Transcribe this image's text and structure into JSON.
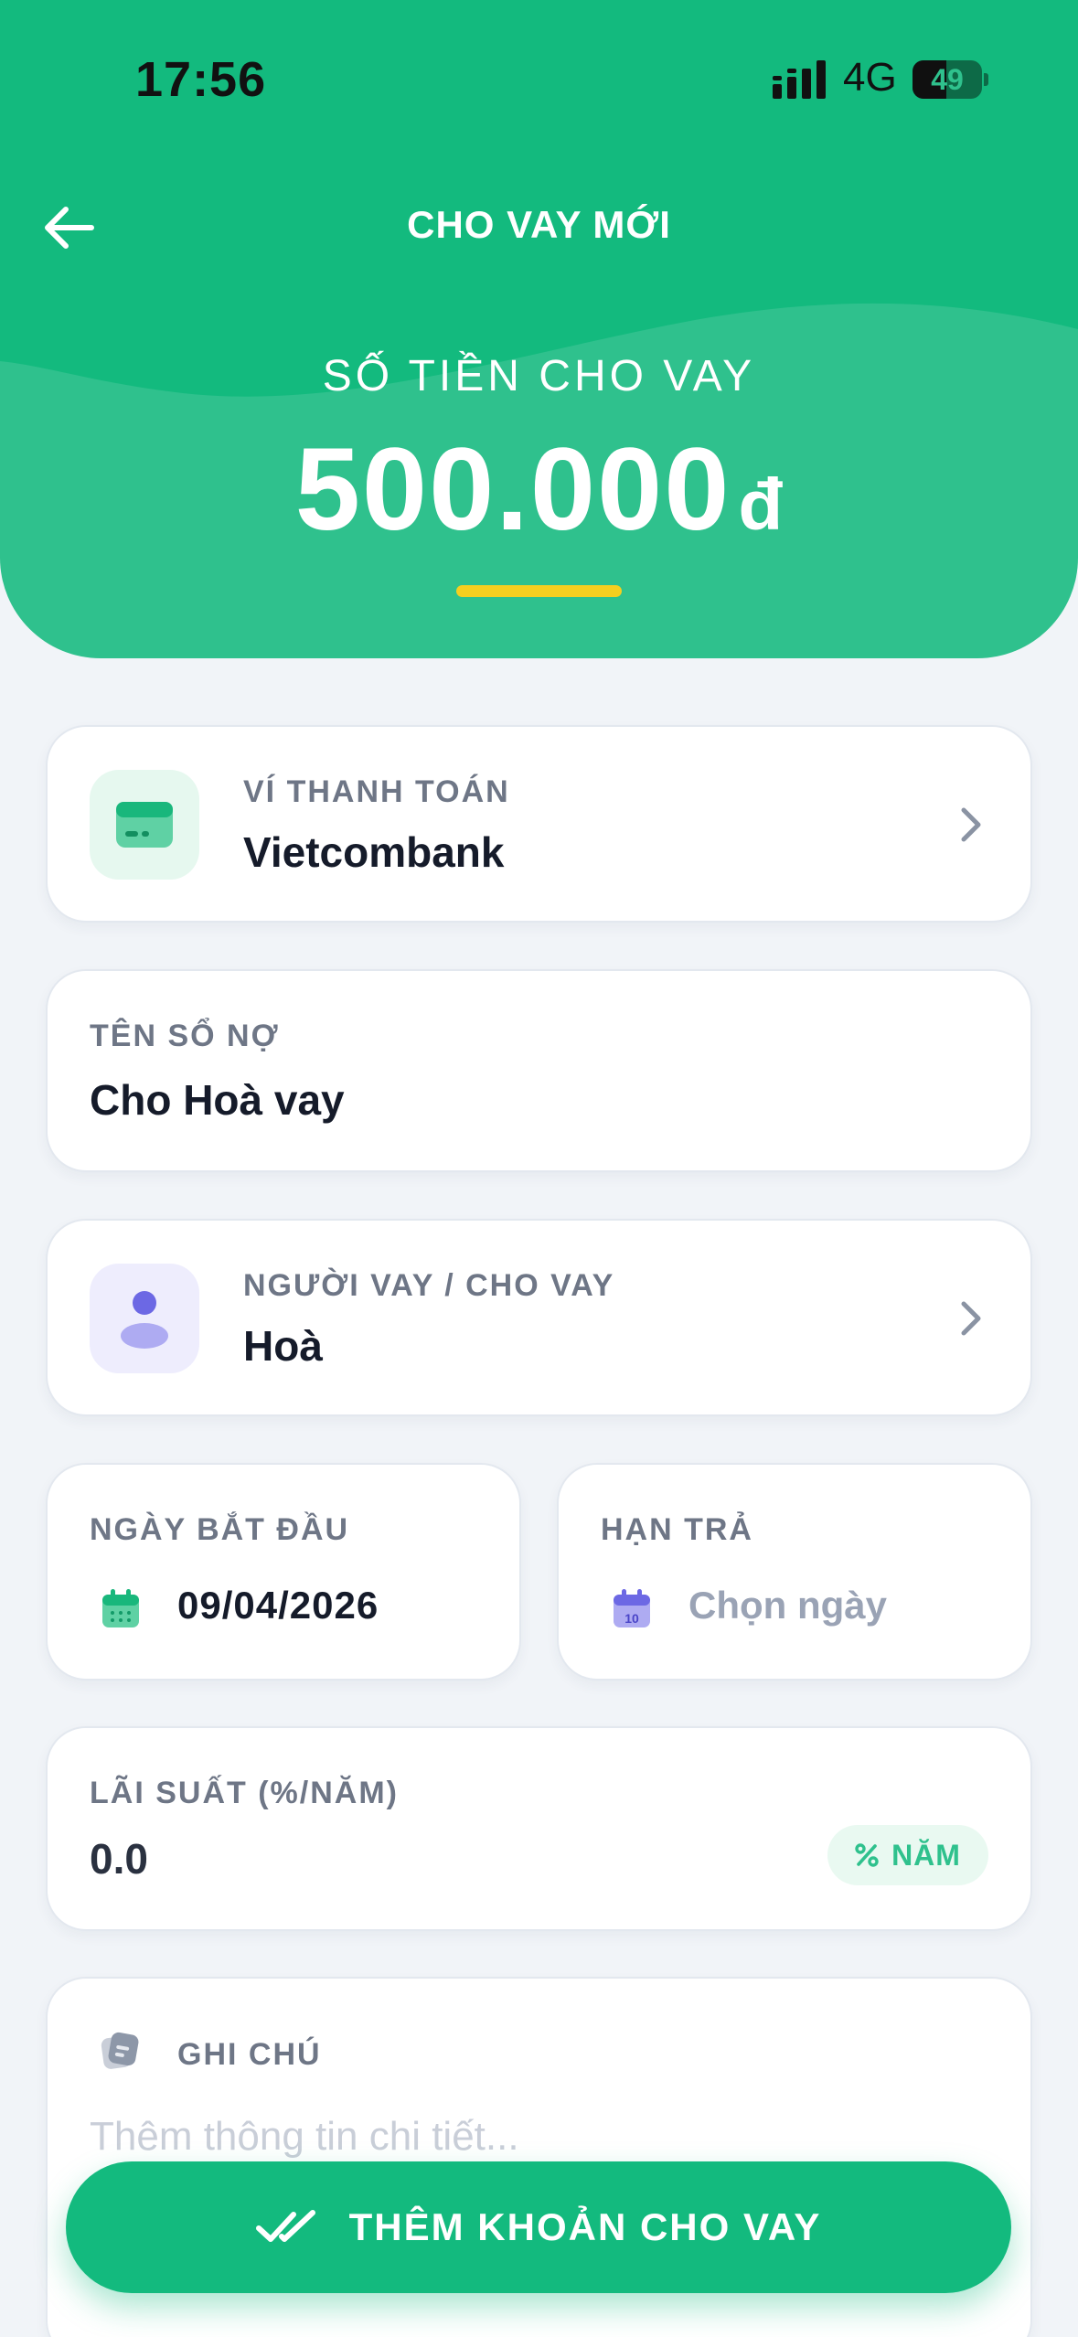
{
  "status_bar": {
    "time": "17:56",
    "network": "4G",
    "battery": "49",
    "battery_level": 0.49
  },
  "header": {
    "title": "CHO VAY MỚI",
    "amount_label": "SỐ TIỀN CHO VAY",
    "amount_value": "500.000",
    "amount_currency": "đ"
  },
  "wallet": {
    "label": "VÍ THANH TOÁN",
    "value": "Vietcombank"
  },
  "ledger": {
    "label": "TÊN SỔ NỢ",
    "value": "Cho Hoà vay"
  },
  "person": {
    "label": "NGƯỜI VAY / CHO VAY",
    "value": "Hoà"
  },
  "start_date": {
    "label": "NGÀY BẮT ĐẦU",
    "value": "09/04/2026"
  },
  "due_date": {
    "label": "HẠN TRẢ",
    "placeholder": "Chọn ngày",
    "calendar_day": "10"
  },
  "interest": {
    "label": "LÃI SUẤT (%/NĂM)",
    "value": "0.0",
    "unit": "NĂM"
  },
  "note": {
    "label": "GHI CHÚ",
    "placeholder": "Thêm thông tin chi tiết..."
  },
  "submit": {
    "label": "THÊM KHOẢN CHO VAY"
  },
  "colors": {
    "primary": "#2fc18d",
    "header": "#13ba7e",
    "accent_underline": "#f6cf1f",
    "person_icon": "#6c68e4"
  }
}
